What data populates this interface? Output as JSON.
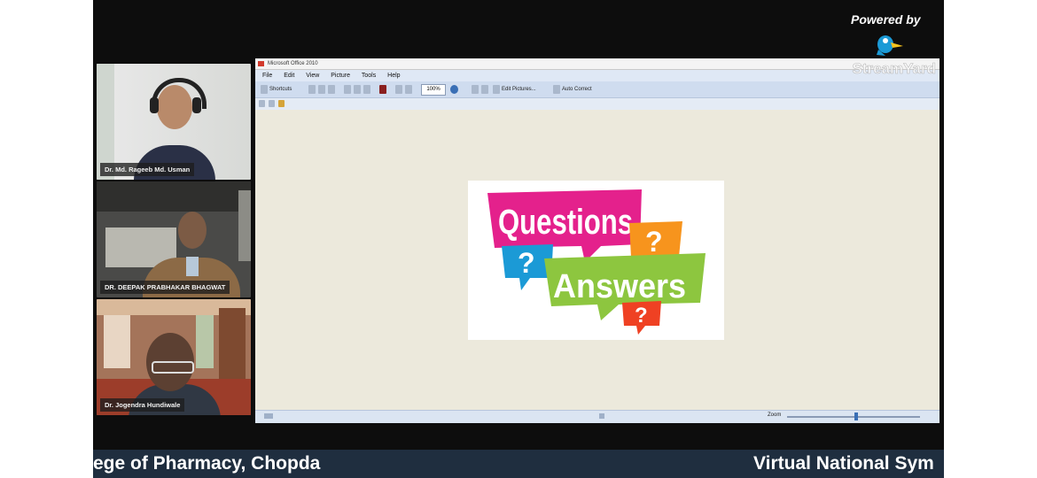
{
  "powered_by": "Powered by",
  "participants": [
    {
      "name": "Dr. Md. Rageeb Md. Usman"
    },
    {
      "name": "DR. DEEPAK PRABHAKAR BHAGWAT"
    },
    {
      "name": "Dr. Jogendra Hundiwale"
    }
  ],
  "shared_window": {
    "title": "Microsoft Office 2010",
    "menu": [
      "File",
      "Edit",
      "View",
      "Picture",
      "Tools",
      "Help"
    ],
    "toolbar": {
      "shortcuts_label": "Shortcuts",
      "zoom_value": "100%",
      "edit_pictures_label": "Edit Pictures...",
      "auto_correct_label": "Auto Correct"
    },
    "status_zoom_label": "Zoom",
    "watermark": "StreamYard",
    "image": {
      "questions": "Questions",
      "answers": "Answers",
      "mark": "?"
    }
  },
  "banner": {
    "left_text": "ege of Pharmacy, Chopda",
    "right_text": "Virtual National Sym"
  },
  "colors": {
    "stage_bg": "#0d0d0d",
    "banner_bg": "#1f2e3f",
    "questions_bg": "#e4218c",
    "answers_bg": "#8dc63f",
    "q_orange": "#f7941d",
    "q_blue": "#1b9ad6",
    "q_red": "#ef4123"
  }
}
